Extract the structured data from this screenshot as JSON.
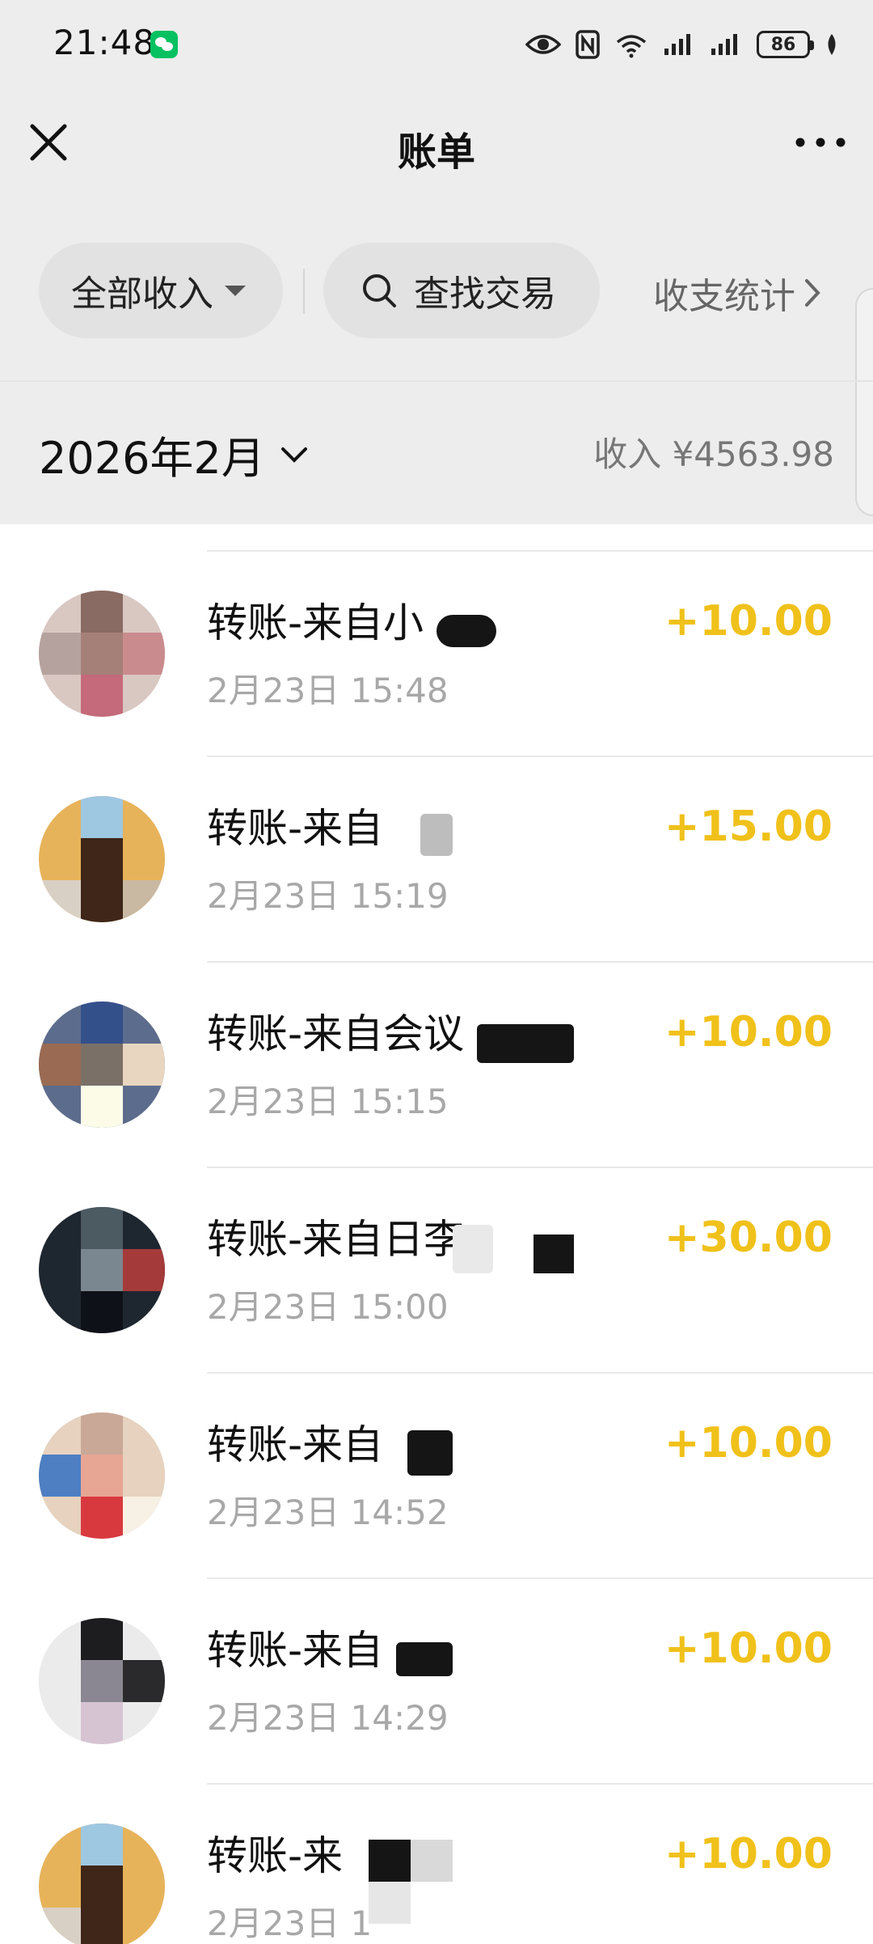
{
  "status_bar": {
    "time": "21:48",
    "battery": "86",
    "icons": [
      "eye-icon",
      "nfc-icon",
      "wifi-icon",
      "signal-icon",
      "signal-icon",
      "battery-icon",
      "leaf-icon"
    ]
  },
  "nav": {
    "title": "账单",
    "close_icon": "close-icon",
    "more_icon": "more-icon"
  },
  "filters": {
    "income_label": "全部收入",
    "search_label": "查找交易",
    "stats_label": "收支统计"
  },
  "month": {
    "label": "2026年2月",
    "total": "收入 ¥4563.98"
  },
  "colors": {
    "amount": "#f0c11a",
    "background_top": "#ededed",
    "pill": "#e2e2e2"
  },
  "transactions": [
    {
      "title": "转账-来自小",
      "time": "2月23日 15:48",
      "amount": "+10.00"
    },
    {
      "title": "转账-来自",
      "time": "2月23日 15:19",
      "amount": "+15.00"
    },
    {
      "title": "转账-来自会议",
      "time": "2月23日 15:15",
      "amount": "+10.00"
    },
    {
      "title": "转账-来自日李",
      "time": "2月23日 15:00",
      "amount": "+30.00"
    },
    {
      "title": "转账-来自",
      "time": "2月23日 14:52",
      "amount": "+10.00"
    },
    {
      "title": "转账-来自",
      "time": "2月23日 14:29",
      "amount": "+10.00"
    },
    {
      "title": "转账-来",
      "time": "2月23日 1",
      "amount": "+10.00"
    }
  ]
}
